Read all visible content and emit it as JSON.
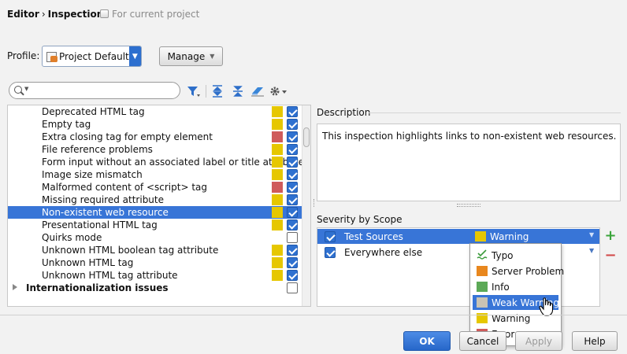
{
  "header": {
    "breadcrumb_parent": "Editor",
    "breadcrumb_separator": "›",
    "breadcrumb_current": "Inspections",
    "scope_note": "For current project"
  },
  "profile": {
    "label": "Profile:",
    "value": "Project Default",
    "manage_label": "Manage"
  },
  "search": {
    "value": "",
    "placeholder": ""
  },
  "toolbar": {
    "icons": [
      "filter-icon",
      "expand-all-icon",
      "collapse-all-icon",
      "eraser-icon",
      "gear-icon"
    ]
  },
  "inspections": [
    {
      "name": "Deprecated HTML tag",
      "severity": "warning",
      "enabled": true
    },
    {
      "name": "Empty tag",
      "severity": "warning",
      "enabled": true
    },
    {
      "name": "Extra closing tag for empty element",
      "severity": "error",
      "enabled": true
    },
    {
      "name": "File reference problems",
      "severity": "warning",
      "enabled": true
    },
    {
      "name": "Form input without an associated label or title attribute",
      "severity": "warning",
      "enabled": true
    },
    {
      "name": "Image size mismatch",
      "severity": "warning",
      "enabled": true
    },
    {
      "name": "Malformed content of <script> tag",
      "severity": "error",
      "enabled": true
    },
    {
      "name": "Missing required attribute",
      "severity": "warning",
      "enabled": true
    },
    {
      "name": "Non-existent web resource",
      "severity": "warning",
      "enabled": true,
      "selected": true
    },
    {
      "name": "Presentational HTML tag",
      "severity": "warning",
      "enabled": true
    },
    {
      "name": "Quirks mode",
      "severity": "",
      "enabled": false
    },
    {
      "name": "Unknown HTML boolean tag attribute",
      "severity": "warning",
      "enabled": true
    },
    {
      "name": "Unknown HTML tag",
      "severity": "warning",
      "enabled": true
    },
    {
      "name": "Unknown HTML tag attribute",
      "severity": "warning",
      "enabled": true
    }
  ],
  "group": {
    "name": "Internationalization issues",
    "enabled": false
  },
  "description": {
    "title": "Description",
    "text": "This inspection highlights links to non-existent web resources."
  },
  "severity_scope": {
    "title": "Severity by Scope",
    "rows": [
      {
        "scope": "Test Sources",
        "severity": "Warning",
        "enabled": true,
        "selected": true
      },
      {
        "scope": "Everywhere else",
        "severity": "",
        "enabled": true,
        "selected": false
      }
    ],
    "add_icon": "plus-icon",
    "remove_icon": "minus-icon"
  },
  "severity_options": [
    {
      "label": "Typo",
      "color": ""
    },
    {
      "label": "Server Problem",
      "color": "#e8871e"
    },
    {
      "label": "Info",
      "color": "#5ca957"
    },
    {
      "label": "Weak Warning",
      "color": "#c9c3b4",
      "highlighted": true
    },
    {
      "label": "Warning",
      "color": "#e6c700"
    },
    {
      "label": "Error",
      "color": "#cf5b5b"
    }
  ],
  "colors": {
    "warning": "#e6c700",
    "error": "#cf5b5b",
    "selection": "#3875d7",
    "checkbox": "#2f71d0"
  },
  "buttons": {
    "ok": "OK",
    "cancel": "Cancel",
    "apply": "Apply",
    "help": "Help"
  }
}
